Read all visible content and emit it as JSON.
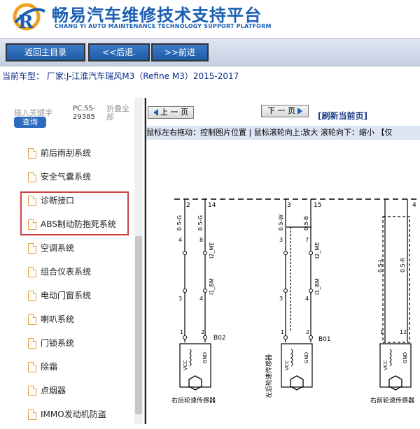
{
  "header": {
    "title_cn": "畅易汽车维修技术支持平台",
    "title_en": "CHANG YI AUTO MAINTENANCE TECHNOLOGY SUPPORT PLATFORM",
    "brand_color": "#1a5fb4"
  },
  "nav": {
    "home_label": "返回主目录",
    "back_label": "<<后退.",
    "forward_label": ">>前进"
  },
  "vehicle": {
    "text": "当前车型： 厂家:J-江淮汽车瑞风M3（Refine M3）2015-2017"
  },
  "left": {
    "search_placeholder": "输入关键字",
    "search_button": "查询",
    "code": "PC.55-29385",
    "collapse": "折叠全部",
    "items": [
      "前后雨刮系统",
      "安全气囊系统",
      "诊断接口",
      "ABS制动防抱死系统",
      "空调系统",
      "组合仪表系统",
      "电动门窗系统",
      "喇叭系统",
      "门锁系统",
      "除霜",
      "点烟器",
      "IMMO发动机防盗"
    ]
  },
  "right": {
    "prev_label": "上 一 页",
    "next_label": "下 一 页",
    "refresh_label": "[刷新当前页]",
    "hint": "鼠标左右拖动：控制图片位置 | 鼠标滚轮向上:放大  滚轮向下：缩小 【仅",
    "diagram": {
      "pins_top": [
        "2",
        "14",
        "3",
        "15",
        "4"
      ],
      "wires": [
        "0.5-G",
        "0.5-G",
        "0.5-W",
        "0.5-B",
        "0.5-L",
        "0.5-R"
      ],
      "mid_connectors": [
        "4",
        "8",
        "I2_ME",
        "3",
        "7",
        "I2_ME"
      ],
      "low_connectors": [
        "3",
        "4",
        "I1_BM",
        "3",
        "4",
        "I1_BM"
      ],
      "bottom_pins": [
        "1",
        "2",
        "1",
        "2",
        "1",
        "12"
      ],
      "sensor_codes": [
        "B02",
        "B01"
      ],
      "pin_labels": [
        "VCC",
        "GND",
        "VCC",
        "GND",
        "VCC",
        "GND"
      ],
      "sensor_names": [
        "右后轮速传感器",
        "左后轮速传感器",
        "右前轮速传感器"
      ]
    }
  }
}
